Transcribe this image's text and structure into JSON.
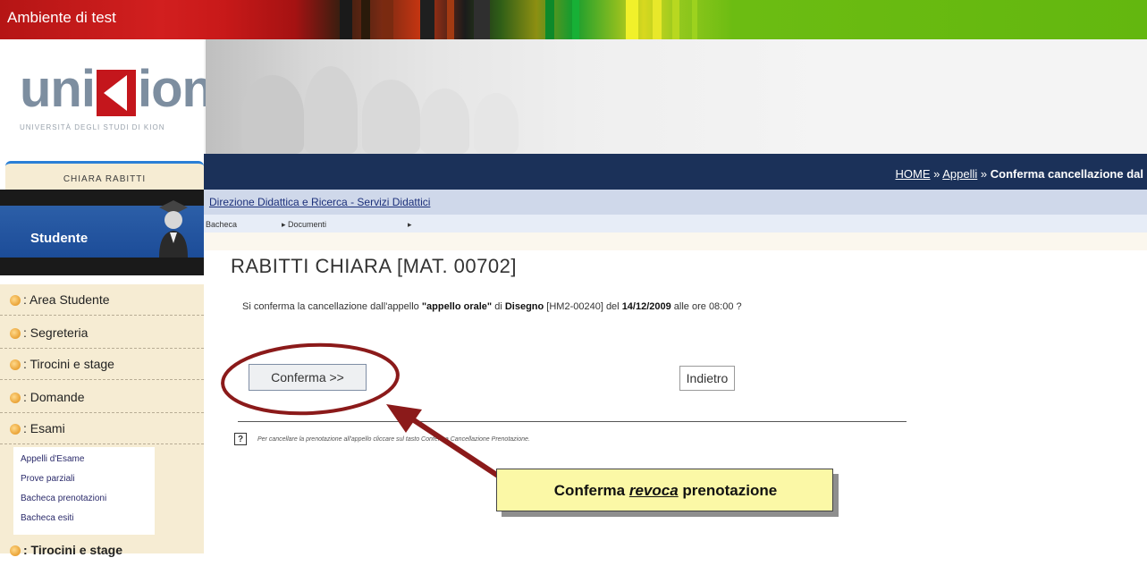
{
  "env_label": "Ambiente di test",
  "logo": {
    "text_left": "uni",
    "text_right": "ion",
    "subtitle": "UNIVERSITÀ DEGLI STUDI DI KION"
  },
  "breadcrumb": {
    "home": "HOME",
    "sep1": " » ",
    "appelli": "Appelli",
    "sep2": " » ",
    "current": "Conferma cancellazione dal"
  },
  "user": {
    "name": "CHIARA RABITTI",
    "role": "Studente"
  },
  "left_nav": [
    {
      "label": ": Area Studente"
    },
    {
      "label": ": Segreteria"
    },
    {
      "label": ": Tirocini e stage"
    },
    {
      "label": ": Domande"
    },
    {
      "label": ": Esami"
    }
  ],
  "sub_nav": [
    "Appelli d'Esame",
    "Prove parziali",
    "Bacheca prenotazioni",
    "Bacheca esiti"
  ],
  "left_nav_bottom": ": Tirocini e stage",
  "service_title": "Direzione Didattica e Ricerca - Servizi Didattici",
  "menu": {
    "item1": "Bacheca",
    "item2": "Documenti"
  },
  "student_heading": "RABITTI CHIARA [MAT. 00702]",
  "confirm": {
    "prefix": "Si conferma la cancellazione dall'appello ",
    "appello": "\"appello orale\"",
    "mid": " di ",
    "course": "Disegno",
    "code": " [HM2-00240] ",
    "del": "del ",
    "date": "14/12/2009",
    "suffix": " alle ore 08:00 ?"
  },
  "buttons": {
    "confirm": "Conferma >>",
    "back": "Indietro"
  },
  "help_text": "Per cancellare la prenotazione all'appello cliccare sul tasto Conferma Cancellazione Prenotazione.",
  "callout": {
    "pre": "Conferma ",
    "em": "revoca",
    "post": " prenotazione"
  },
  "colors": {
    "nav_dark": "#1b3159",
    "role_blue": "#1c4c98",
    "annotation_red": "#8b1a1a",
    "callout_yellow": "#fbf8a6"
  },
  "icons": {
    "bullet": "orange-bullet-icon",
    "help": "help-icon",
    "avatar": "graduate-avatar-icon"
  }
}
